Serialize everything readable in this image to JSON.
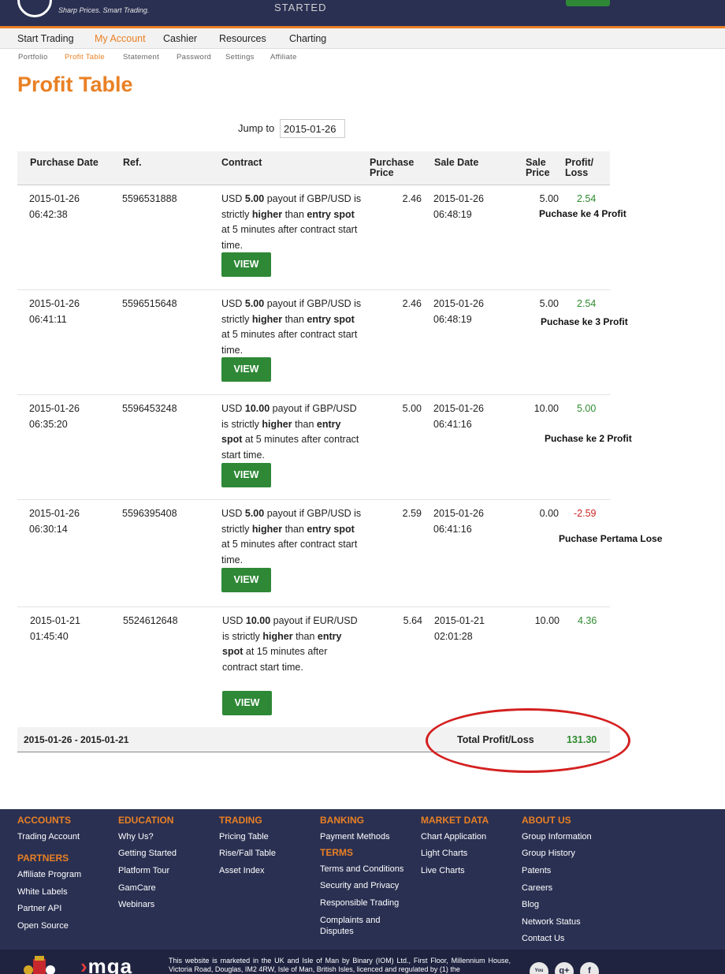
{
  "header": {
    "tagline": "Sharp Prices. Smart Trading.",
    "get_started": "STARTED",
    "nav": [
      "Start Trading",
      "My Account",
      "Cashier",
      "Resources",
      "Charting"
    ],
    "active_nav": "My Account",
    "subnav": [
      "Portfolio",
      "Profit Table",
      "Statement",
      "Password",
      "Settings",
      "Affiliate"
    ],
    "active_subnav": "Profit Table"
  },
  "page": {
    "title": "Profit Table",
    "jump_label": "Jump to",
    "jump_value": "2015-01-26"
  },
  "table": {
    "headers": {
      "purchase_date": "Purchase Date",
      "ref": "Ref.",
      "contract": "Contract",
      "purchase_price_1": "Purchase",
      "purchase_price_2": "Price",
      "sale_date": "Sale Date",
      "sale_price_1": "Sale",
      "sale_price_2": "Price",
      "profit_1": "Profit/",
      "profit_2": "Loss"
    },
    "view_label": "VIEW",
    "rows": [
      {
        "purchase_date": "2015-01-26",
        "purchase_time": "06:42:38",
        "ref": "5596531888",
        "contract_html": "USD <b>5.00</b> payout if GBP/USD is strictly <b>higher</b> than <b>entry spot</b> at 5 minutes after contract start time.",
        "purchase_price": "2.46",
        "sale_date": "2015-01-26",
        "sale_time": "06:48:19",
        "sale_price": "5.00",
        "profit": "2.54",
        "note": "Puchase ke 4 Profit"
      },
      {
        "purchase_date": "2015-01-26",
        "purchase_time": "06:41:11",
        "ref": "5596515648",
        "contract_html": "USD <b>5.00</b> payout if GBP/USD is strictly <b>higher</b> than <b>entry spot</b> at 5 minutes after contract start time.",
        "purchase_price": "2.46",
        "sale_date": "2015-01-26",
        "sale_time": "06:48:19",
        "sale_price": "5.00",
        "profit": "2.54",
        "note": "Puchase ke 3 Profit"
      },
      {
        "purchase_date": "2015-01-26",
        "purchase_time": "06:35:20",
        "ref": "5596453248",
        "contract_html": "USD <b>10.00</b> payout if GBP/USD is strictly <b>higher</b> than <b>entry spot</b> at 5 minutes after contract start time.",
        "purchase_price": "5.00",
        "sale_date": "2015-01-26",
        "sale_time": "06:41:16",
        "sale_price": "10.00",
        "profit": "5.00",
        "note": "Puchase ke 2 Profit"
      },
      {
        "purchase_date": "2015-01-26",
        "purchase_time": "06:30:14",
        "ref": "5596395408",
        "contract_html": "USD <b>5.00</b> payout if GBP/USD is strictly <b>higher</b> than <b>entry spot</b> at 5 minutes after contract start time.",
        "purchase_price": "2.59",
        "sale_date": "2015-01-26",
        "sale_time": "06:41:16",
        "sale_price": "0.00",
        "profit": "-2.59",
        "note": "Puchase Pertama Lose"
      },
      {
        "purchase_date": "2015-01-21",
        "purchase_time": "01:45:40",
        "ref": "5524612648",
        "contract_html": "USD <b>10.00</b> payout if EUR/USD is strictly <b>higher</b> than <b>entry spot</b> at 15 minutes after contract start time.",
        "purchase_price": "5.64",
        "sale_date": "2015-01-21",
        "sale_time": "02:01:28",
        "sale_price": "10.00",
        "profit": "4.36",
        "note": ""
      }
    ],
    "total": {
      "range": "2015-01-26 - 2015-01-21",
      "label": "Total Profit/Loss",
      "value": "131.30"
    }
  },
  "footer": {
    "columns": [
      {
        "heading": "ACCOUNTS",
        "links": [
          "Trading Account"
        ]
      },
      {
        "heading": "PARTNERS",
        "links": [
          "Affiliate Program",
          "White Labels",
          "Partner API",
          "Open Source"
        ]
      },
      {
        "heading": "EDUCATION",
        "links": [
          "Why Us?",
          "Getting Started",
          "Platform Tour",
          "GamCare",
          "Webinars"
        ]
      },
      {
        "heading": "TRADING",
        "links": [
          "Pricing Table",
          "Rise/Fall Table",
          "Asset Index"
        ]
      },
      {
        "heading": "BANKING",
        "links": [
          "Payment Methods"
        ]
      },
      {
        "heading": "TERMS",
        "links": [
          "Terms and Conditions",
          "Security and Privacy",
          "Responsible Trading",
          "Complaints and Disputes"
        ]
      },
      {
        "heading": "MARKET DATA",
        "links": [
          "Chart Application",
          "Light Charts",
          "Live Charts"
        ]
      },
      {
        "heading": "ABOUT US",
        "links": [
          "Group Information",
          "Group History",
          "Patents",
          "Careers",
          "Blog",
          "Network Status",
          "Contact Us"
        ]
      }
    ],
    "mga": "mga",
    "legal": "This website is marketed in the UK and Isle of Man by Binary (IOM) Ltd., First Floor, Millennium House, Victoria Road, Douglas, IM2 4RW, Isle of Man, British Isles, licenced and regulated by (1) the",
    "social": [
      "You Tube",
      "g+",
      "f"
    ]
  },
  "colors": {
    "brand_orange": "#e98024",
    "header_navy": "#2a3052",
    "button_green": "#2e8836",
    "profit_green": "#2e8b2e",
    "loss_red": "#cc2222",
    "annotation_red": "#d42020"
  }
}
